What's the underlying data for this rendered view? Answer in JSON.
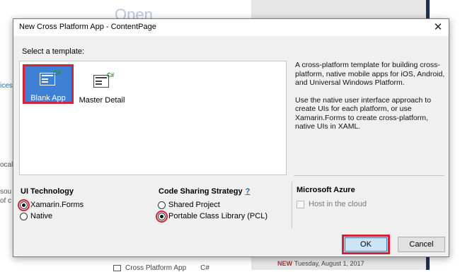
{
  "background": {
    "heading": "Open",
    "fragments": [
      "ices",
      "ocal",
      "sou",
      "of c"
    ],
    "bottom_item": "Cross Platform App",
    "bottom_item_lang": "C#",
    "news_badge": "NEW",
    "news_date": "Tuesday, August 1, 2017"
  },
  "dialog": {
    "title": "New Cross Platform App - ContentPage",
    "close_glyph": "✕",
    "select_label": "Select a template:",
    "templates": [
      {
        "label": "Blank App",
        "badge": "C#",
        "selected": true
      },
      {
        "label": "Master Detail",
        "badge": "C#",
        "selected": false
      }
    ],
    "description": [
      "A cross-platform template for building cross-platform, native mobile apps for iOS, Android, and Universal Windows Platform.",
      "Use the native user interface approach to create UIs for each platform, or use Xamarin.Forms to create cross-platform, native UIs in XAML."
    ],
    "ui_technology": {
      "title": "UI Technology",
      "options": [
        {
          "label": "Xamarin.Forms",
          "checked": true
        },
        {
          "label": "Native",
          "checked": false
        }
      ]
    },
    "code_sharing": {
      "title": "Code Sharing Strategy",
      "help": "?",
      "options": [
        {
          "label": "Shared Project",
          "checked": false
        },
        {
          "label": "Portable Class Library (PCL)",
          "checked": true
        }
      ]
    },
    "azure": {
      "title": "Microsoft Azure",
      "host_label": "Host in the cloud",
      "host_checked": false
    },
    "buttons": {
      "ok": "OK",
      "cancel": "Cancel"
    }
  },
  "colors": {
    "highlight": "#d22438",
    "selection": "#3d80d4",
    "ok_bg": "#cce4f7"
  }
}
